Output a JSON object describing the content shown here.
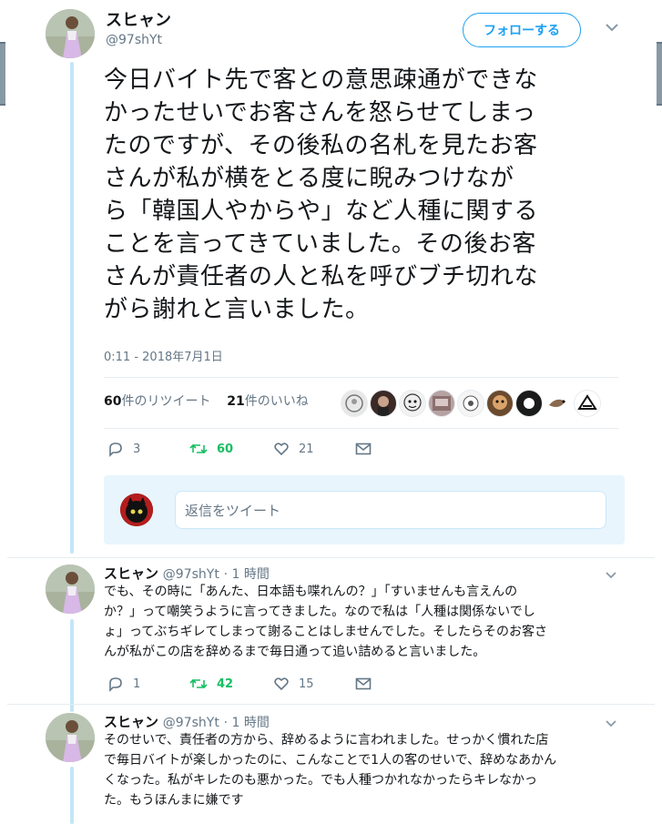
{
  "tweet": {
    "display_name": "スヒャン",
    "handle": "@97shYt",
    "follow_label": "フォローする",
    "text_lines": [
      "今日バイト先で客との意思疎通ができな",
      "かったせいでお客さんを怒らせてしまっ",
      "たのですが、その後私の名札を見たお客",
      "さんが私が横をとる度に睨みつけなが",
      "ら「韓国人やからや」など人種に関する",
      "ことを言ってきていました。その後お客",
      "さんが責任者の人と私を呼びブチ切れな",
      "がら謝れと言いました。"
    ],
    "timestamp": "0:11 - 2018年7月1日",
    "retweets_count": "60",
    "retweets_label": "件のリツイート",
    "likes_count": "21",
    "likes_label": "件のいいね",
    "actions": {
      "replies": "3",
      "retweets": "60",
      "likes": "21"
    }
  },
  "reply_box": {
    "placeholder": "返信をツイート"
  },
  "replies": [
    {
      "display_name": "スヒャン",
      "handle": "@97shYt",
      "time": "· 1 時間",
      "text_lines": [
        "でも、その時に「あんた、日本語も喋れんの？」「すいませんも言えんの",
        "か？」って嘲笑うように言ってきました。なので私は「人種は関係ないでし",
        "ょ」ってぶちギレてしまって謝ることはしませんでした。そしたらそのお客さ",
        "んが私がこの店を辞めるまで毎日通って追い詰めると言いました。"
      ],
      "actions": {
        "replies": "1",
        "retweets": "42",
        "likes": "15"
      }
    },
    {
      "display_name": "スヒャン",
      "handle": "@97shYt",
      "time": "· 1 時間",
      "text_lines": [
        "そのせいで、責任者の方から、辞めるように言われました。せっかく慣れた店",
        "で毎日バイトが楽しかったのに、こんなことで1人の客のせいで、辞めなあかん",
        "くなった。私がキレたのも悪かった。でも人種つかれなかったらキレなかっ",
        "た。もうほんまに嫌です"
      ]
    }
  ],
  "colors": {
    "accent": "#1da1f2",
    "retweet": "#17bf63",
    "muted": "#657786",
    "thread": "#c4e6f6"
  },
  "icons": [
    "caret-down-icon",
    "reply-icon",
    "retweet-icon",
    "like-icon",
    "dm-icon"
  ]
}
